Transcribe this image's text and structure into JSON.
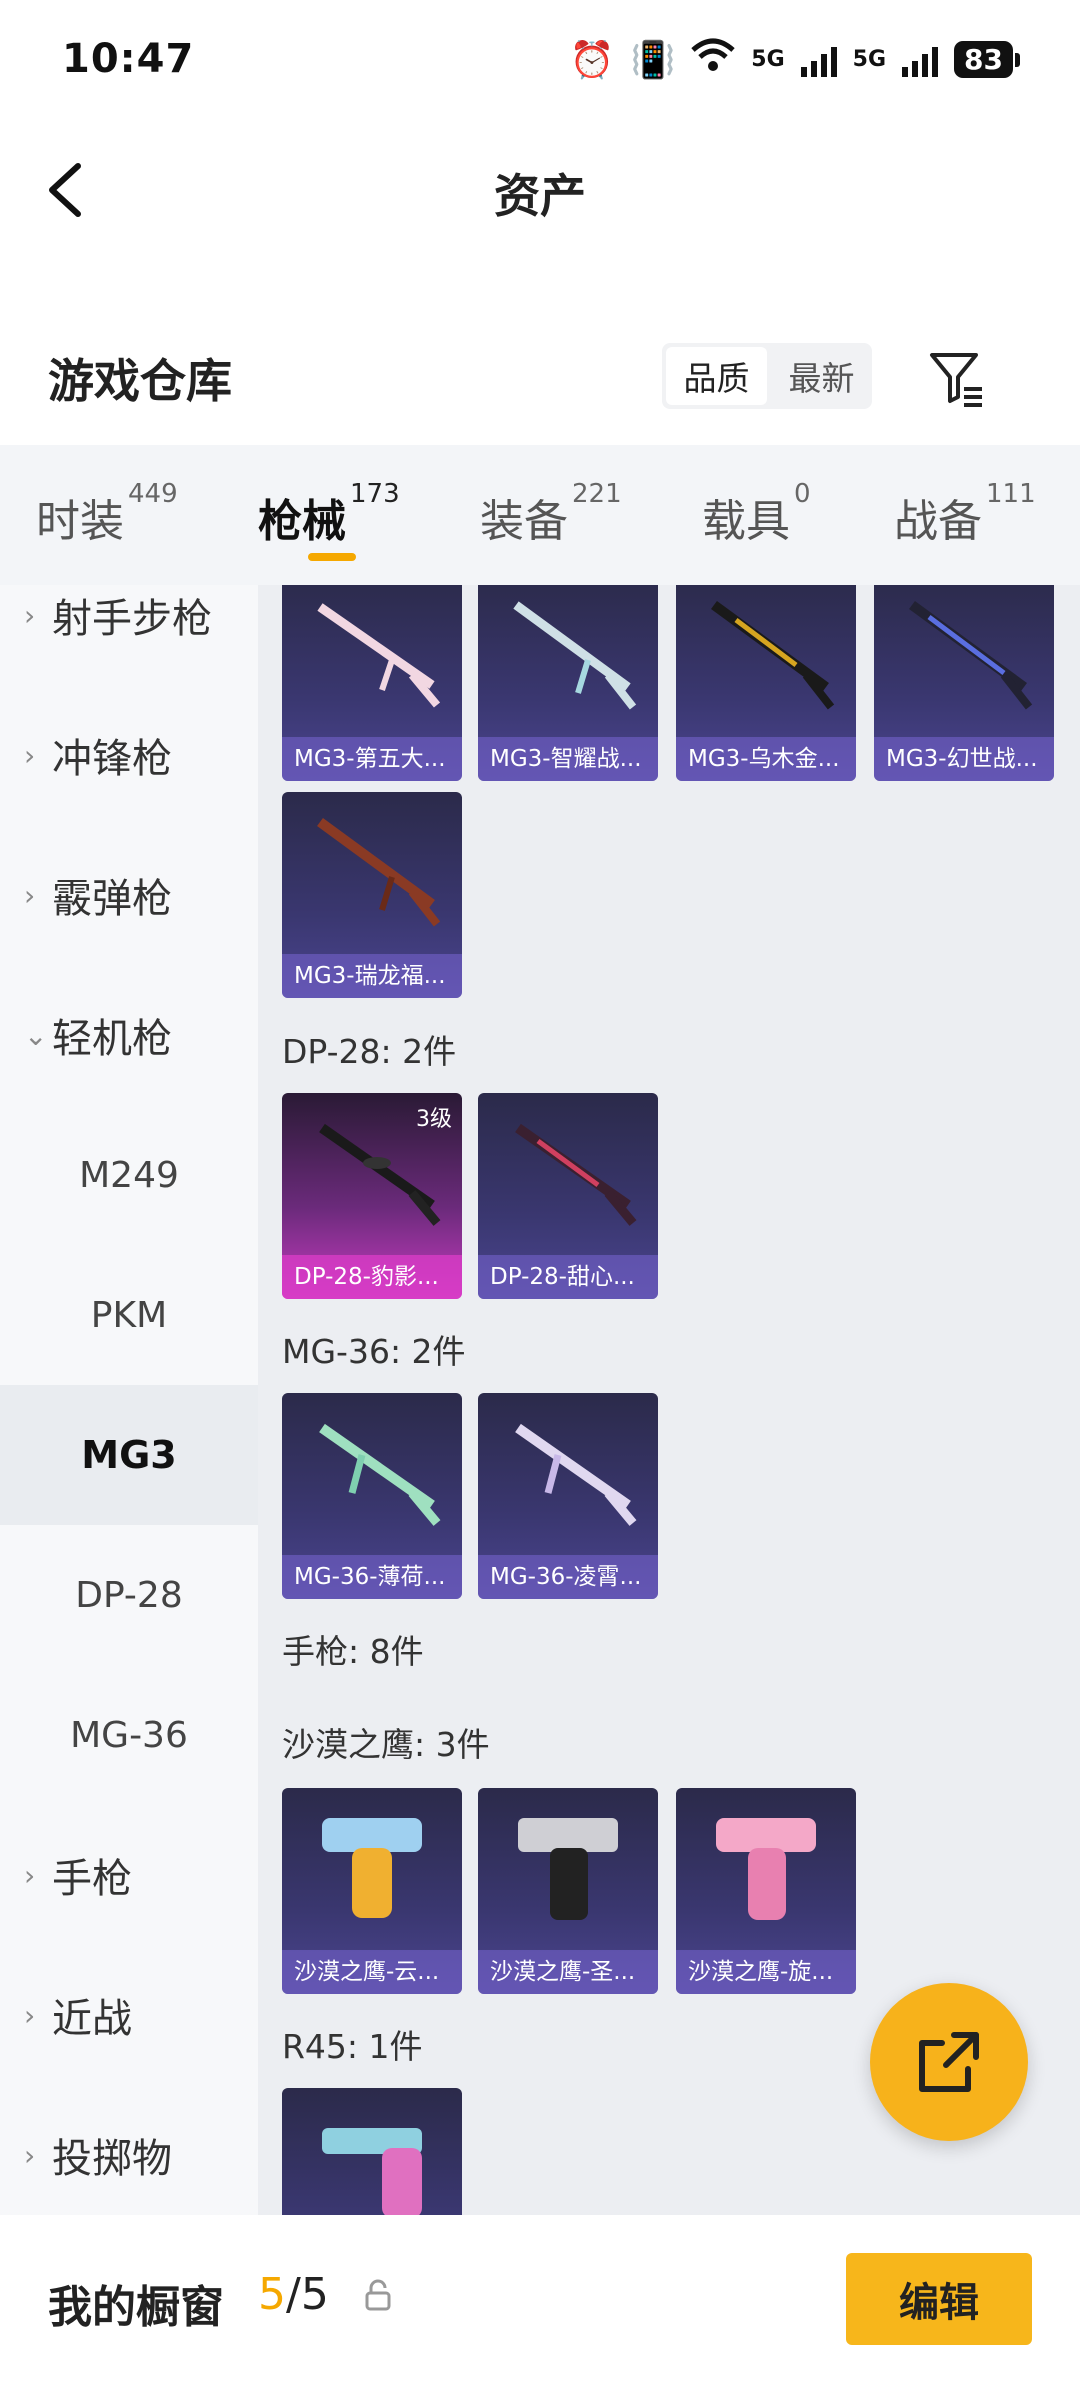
{
  "status_bar": {
    "time": "10:47",
    "network_1": "5G",
    "network_2": "5G",
    "battery": "83",
    "icons": [
      "alarm-icon",
      "vibrate-icon",
      "wifi-icon",
      "signal-icon",
      "signal-icon",
      "battery-icon"
    ]
  },
  "nav": {
    "title": "资产",
    "back_icon": "back-arrow-icon"
  },
  "header": {
    "title": "游戏仓库",
    "sort_options": [
      "品质",
      "最新"
    ],
    "sort_selected": "品质",
    "filter_icon": "filter-icon"
  },
  "tabs": [
    {
      "label": "时装",
      "count": "449"
    },
    {
      "label": "枪械",
      "count": "173"
    },
    {
      "label": "装备",
      "count": "221"
    },
    {
      "label": "载具",
      "count": "0"
    },
    {
      "label": "战备",
      "count": "111"
    }
  ],
  "active_tab": "枪械",
  "sidebar": {
    "categories": [
      "射手步枪",
      "冲锋枪",
      "霰弹枪",
      "轻机枪",
      "手枪",
      "近战",
      "投掷物"
    ],
    "expanded": "轻机枪",
    "subitems": [
      "M249",
      "PKM",
      "MG3",
      "DP-28",
      "MG-36"
    ],
    "selected": "MG3"
  },
  "content": {
    "row_mg3": [
      "MG3-第五大...",
      "MG3-智耀战...",
      "MG3-乌木金...",
      "MG3-幻世战...",
      "MG3-瑞龙福..."
    ],
    "dp28": {
      "label": "DP-28: 2件",
      "items": [
        "DP-28-豹影...",
        "DP-28-甜心..."
      ],
      "level_badge": "3级"
    },
    "mg36": {
      "label": "MG-36: 2件",
      "items": [
        "MG-36-薄荷...",
        "MG-36-凌霄..."
      ]
    },
    "pistol": {
      "label": "手枪: 8件"
    },
    "deagle": {
      "label": "沙漠之鹰: 3件",
      "items": [
        "沙漠之鹰-云...",
        "沙漠之鹰-圣...",
        "沙漠之鹰-旋..."
      ]
    },
    "r45": {
      "label": "R45: 1件"
    }
  },
  "fab": {
    "icon": "share-export-icon"
  },
  "bottom": {
    "label": "我的橱窗",
    "current": "5",
    "total": "/5",
    "lock_icon": "lock-icon",
    "edit_label": "编辑"
  },
  "colors": {
    "accent": "#f5a800",
    "card_purple": "#3a3770",
    "card_pink": "#c63cc0"
  }
}
